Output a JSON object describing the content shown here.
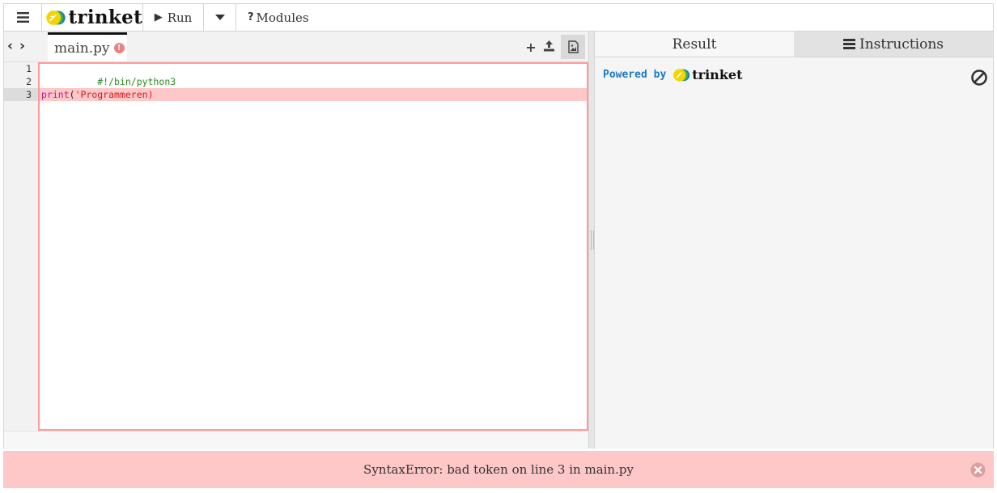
{
  "toolbar": {
    "brand": "trinket",
    "run_label": "Run",
    "modules_label": "Modules",
    "modules_icon": "?"
  },
  "editor": {
    "file_tab": "main.py",
    "file_error_icon": "!",
    "lines": [
      {
        "num": "1",
        "text": "#!/bin/python3"
      },
      {
        "num": "2",
        "text": ""
      },
      {
        "num": "3",
        "kw": "print",
        "paren_open": "(",
        "str": "'Programmeren",
        "paren_close": ")"
      }
    ],
    "highlighted_line": 3
  },
  "result_panel": {
    "tab_result": "Result",
    "tab_instructions": "Instructions",
    "powered_by": "Powered by",
    "powered_brand": "trinket"
  },
  "error": {
    "message": "SyntaxError: bad token on line 3 in main.py"
  },
  "colors": {
    "error_bg": "#ffc8c8",
    "logo_yellow": "#f5d400",
    "logo_green": "#3db34a",
    "logo_blue": "#1a7ac8"
  }
}
